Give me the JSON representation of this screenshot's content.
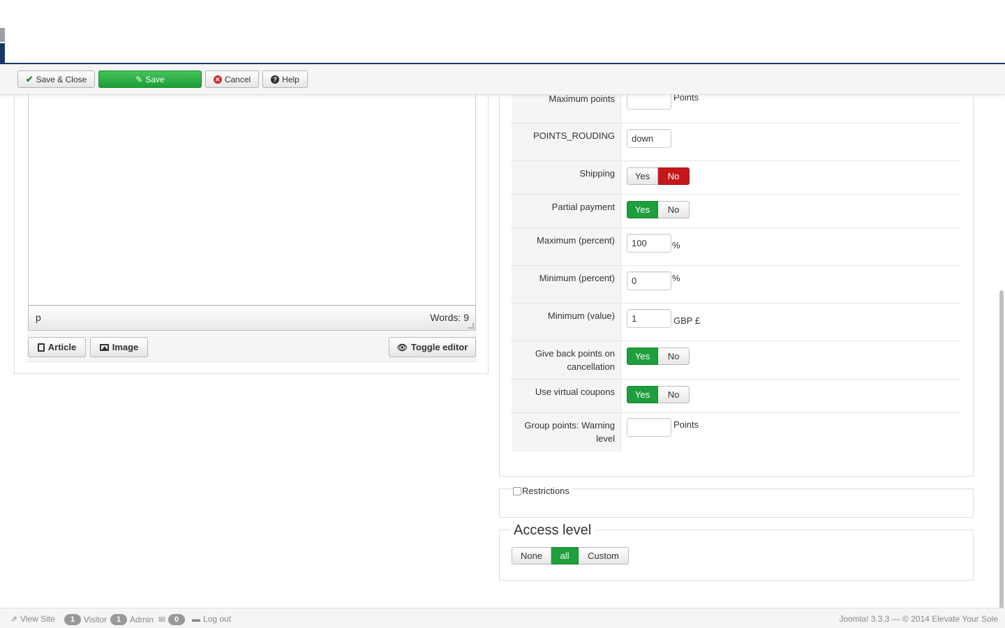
{
  "toolbar": {
    "save_close": "Save & Close",
    "save": "Save",
    "cancel": "Cancel",
    "help": "Help"
  },
  "editor": {
    "path": "p",
    "words": "Words: 9",
    "article_btn": "Article",
    "image_btn": "Image",
    "toggle_btn": "Toggle editor"
  },
  "form": {
    "max_points": {
      "label": "Maximum points",
      "value": "",
      "suffix": "Points"
    },
    "points_rounding": {
      "label": "POINTS_ROUDING",
      "value": "down"
    },
    "shipping": {
      "label": "Shipping",
      "yes": "Yes",
      "no": "No",
      "selected": "No"
    },
    "partial_payment": {
      "label": "Partial payment",
      "yes": "Yes",
      "no": "No",
      "selected": "Yes"
    },
    "max_percent": {
      "label": "Maximum (percent)",
      "value": "100",
      "suffix": "%"
    },
    "min_percent": {
      "label": "Minimum (percent)",
      "value": "0",
      "suffix": "%"
    },
    "min_value": {
      "label": "Minimum (value)",
      "value": "1",
      "suffix": "GBP £"
    },
    "give_back": {
      "label": "Give back points on cancellation",
      "yes": "Yes",
      "no": "No",
      "selected": "Yes"
    },
    "virtual_coupons": {
      "label": "Use virtual coupons",
      "yes": "Yes",
      "no": "No",
      "selected": "Yes"
    },
    "group_points": {
      "label": "Group points: Warning level",
      "value": "",
      "suffix": "Points"
    }
  },
  "restrictions": {
    "label": "Restrictions",
    "checked": false
  },
  "access": {
    "title": "Access level",
    "options": [
      "None",
      "all",
      "Custom"
    ],
    "selected": "all"
  },
  "footer": {
    "view_site": "View Site",
    "visitor_count": "1",
    "visitor_label": "Visitor",
    "admin_count": "1",
    "admin_label": "Admin",
    "msg_count": "0",
    "logout": "Log out",
    "copyright": "Joomla! 3.3.3  —  © 2014 Elevate Your Sole"
  },
  "colors": {
    "green": "#1e9e3c",
    "red": "#c5171b",
    "navy": "#1a3867"
  }
}
